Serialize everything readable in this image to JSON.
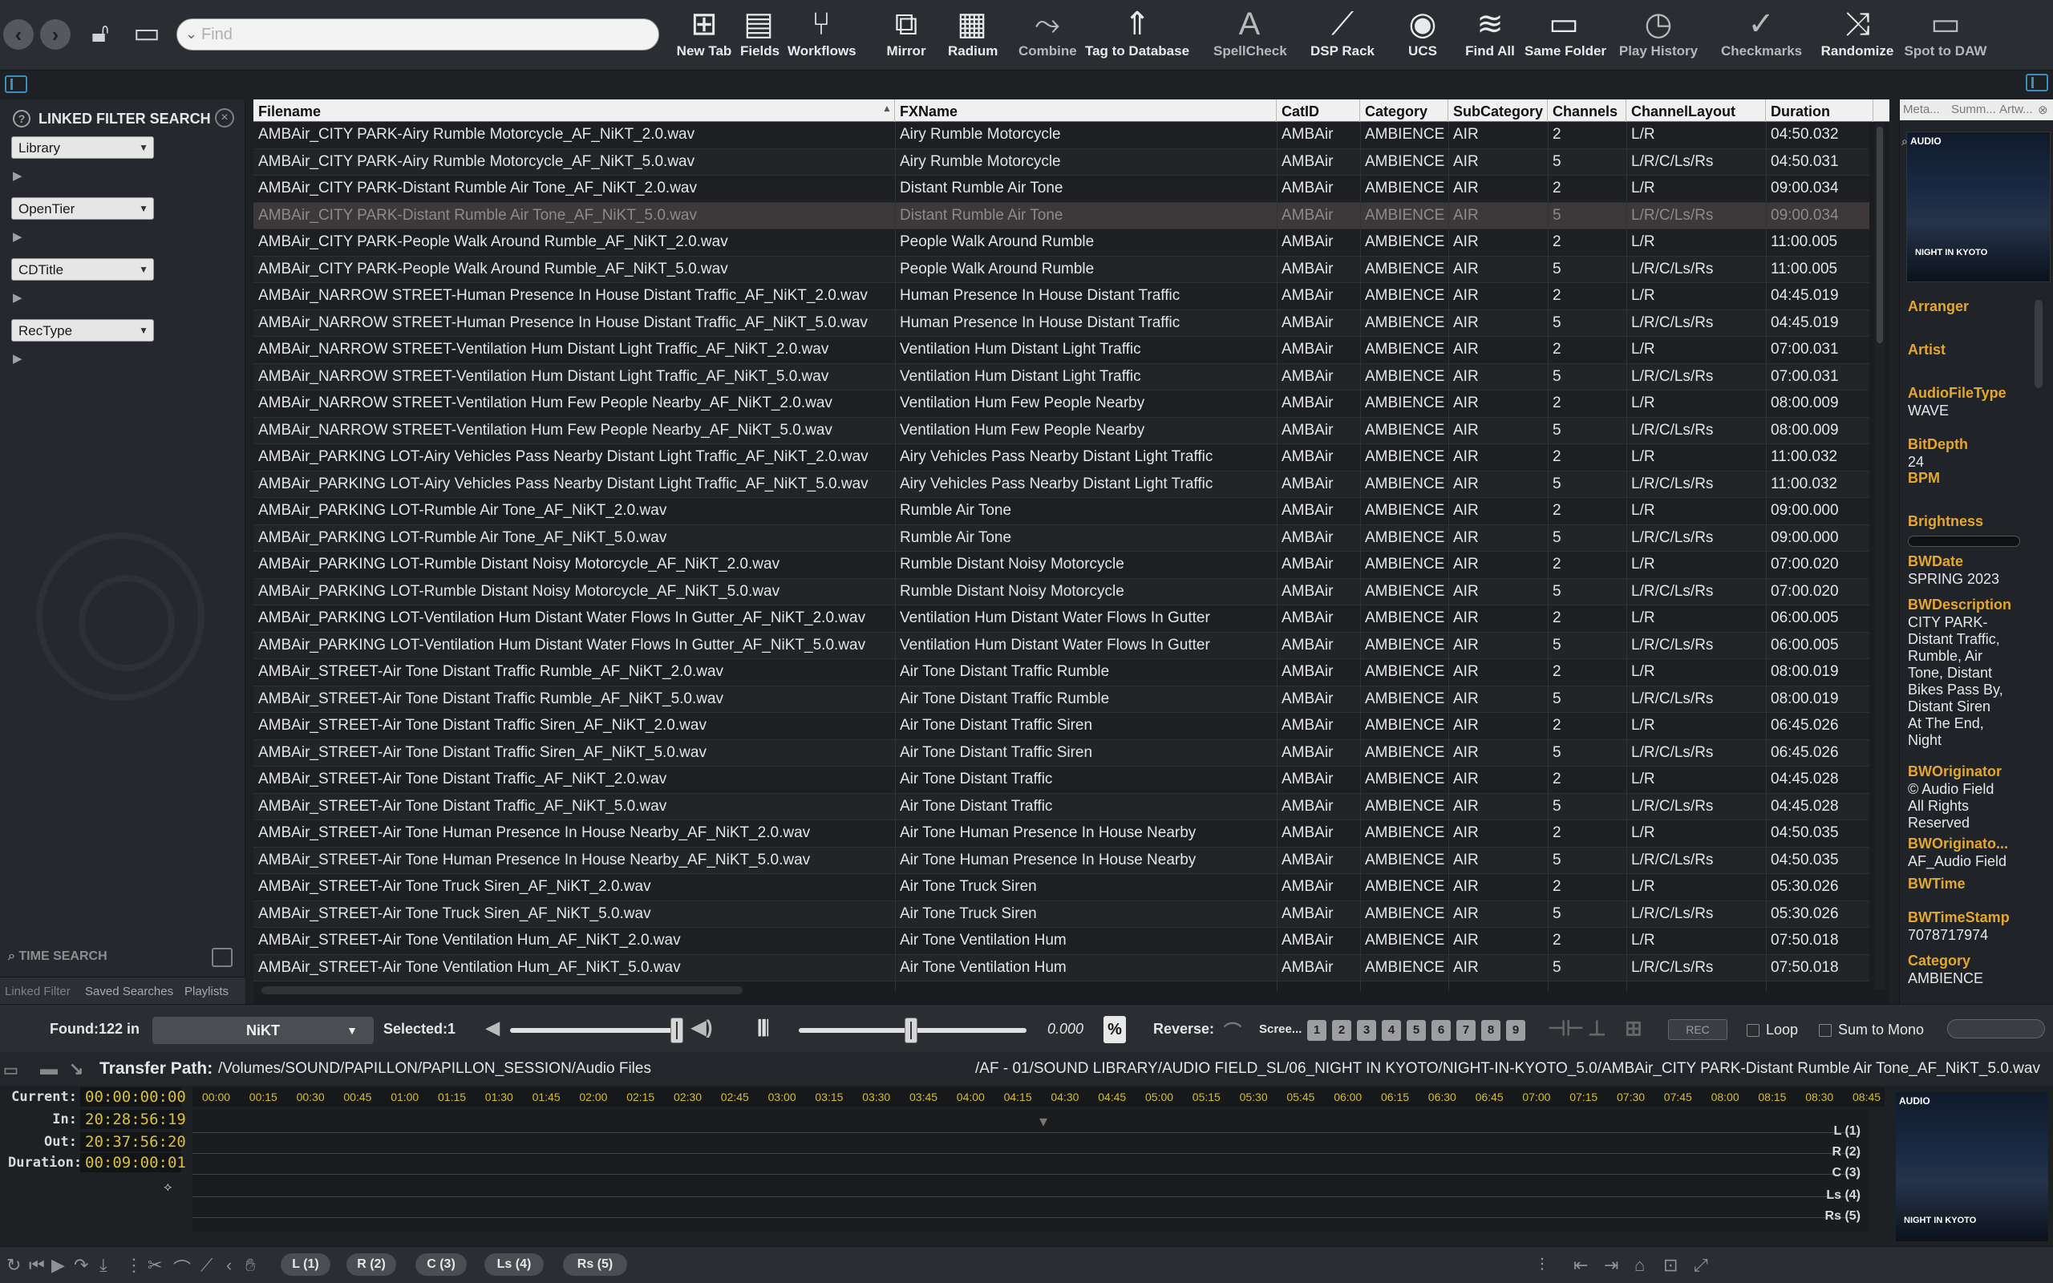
{
  "toolbar": {
    "search_placeholder": "Find",
    "buttons": [
      {
        "label": "New Tab",
        "icon": "new-tab-icon",
        "glyph": "⊞"
      },
      {
        "label": "Fields",
        "icon": "fields-icon",
        "glyph": "▤"
      },
      {
        "label": "Workflows",
        "icon": "workflows-icon",
        "glyph": "⑂"
      },
      {
        "label": "Mirror",
        "icon": "mirror-icon",
        "glyph": "⧉"
      },
      {
        "label": "Radium",
        "icon": "radium-icon",
        "glyph": "▦"
      },
      {
        "label": "Combine",
        "icon": "combine-icon",
        "glyph": "⤳"
      },
      {
        "label": "Tag to Database",
        "icon": "tag-database-icon",
        "glyph": "⇑"
      },
      {
        "label": "SpellCheck",
        "icon": "spellcheck-icon",
        "glyph": "A"
      },
      {
        "label": "DSP Rack",
        "icon": "dsp-rack-icon",
        "glyph": "⟋"
      },
      {
        "label": "UCS",
        "icon": "ucs-icon",
        "glyph": "◉"
      },
      {
        "label": "Find All",
        "icon": "find-all-icon",
        "glyph": "≋"
      },
      {
        "label": "Same Folder",
        "icon": "folder-icon",
        "glyph": "▭"
      },
      {
        "label": "Play History",
        "icon": "clock-icon",
        "glyph": "◷"
      },
      {
        "label": "Checkmarks",
        "icon": "checkmark-icon",
        "glyph": "✓"
      },
      {
        "label": "Randomize",
        "icon": "shuffle-icon",
        "glyph": "⤨"
      },
      {
        "label": "Spot to DAW",
        "icon": "monitor-icon",
        "glyph": "▭"
      }
    ]
  },
  "left_panel": {
    "title": "LINKED FILTER SEARCH",
    "filters": [
      "Library",
      "OpenTier",
      "CDTitle",
      "RecType"
    ],
    "time_search": "TIME SEARCH",
    "tabs": [
      "Linked Filter",
      "Saved Searches",
      "Playlists"
    ]
  },
  "table": {
    "columns": [
      "Filename",
      "FXName",
      "CatID",
      "Category",
      "SubCategory",
      "Channels",
      "ChannelLayout",
      "Duration"
    ],
    "selected_index": 3,
    "rows": [
      [
        "AMBAir_CITY PARK-Airy Rumble Motorcycle_AF_NiKT_2.0.wav",
        "Airy Rumble Motorcycle",
        "AMBAir",
        "AMBIENCE",
        "AIR",
        "2",
        "L/R",
        "04:50.032"
      ],
      [
        "AMBAir_CITY PARK-Airy Rumble Motorcycle_AF_NiKT_5.0.wav",
        "Airy Rumble Motorcycle",
        "AMBAir",
        "AMBIENCE",
        "AIR",
        "5",
        "L/R/C/Ls/Rs",
        "04:50.031"
      ],
      [
        "AMBAir_CITY PARK-Distant Rumble Air Tone_AF_NiKT_2.0.wav",
        "Distant Rumble Air Tone",
        "AMBAir",
        "AMBIENCE",
        "AIR",
        "2",
        "L/R",
        "09:00.034"
      ],
      [
        "AMBAir_CITY PARK-Distant Rumble Air Tone_AF_NiKT_5.0.wav",
        "Distant Rumble Air Tone",
        "AMBAir",
        "AMBIENCE",
        "AIR",
        "5",
        "L/R/C/Ls/Rs",
        "09:00.034"
      ],
      [
        "AMBAir_CITY PARK-People Walk Around Rumble_AF_NiKT_2.0.wav",
        "People Walk Around Rumble",
        "AMBAir",
        "AMBIENCE",
        "AIR",
        "2",
        "L/R",
        "11:00.005"
      ],
      [
        "AMBAir_CITY PARK-People Walk Around Rumble_AF_NiKT_5.0.wav",
        "People Walk Around Rumble",
        "AMBAir",
        "AMBIENCE",
        "AIR",
        "5",
        "L/R/C/Ls/Rs",
        "11:00.005"
      ],
      [
        "AMBAir_NARROW STREET-Human Presence In House Distant Traffic_AF_NiKT_2.0.wav",
        "Human Presence In House Distant Traffic",
        "AMBAir",
        "AMBIENCE",
        "AIR",
        "2",
        "L/R",
        "04:45.019"
      ],
      [
        "AMBAir_NARROW STREET-Human Presence In House Distant Traffic_AF_NiKT_5.0.wav",
        "Human Presence In House Distant Traffic",
        "AMBAir",
        "AMBIENCE",
        "AIR",
        "5",
        "L/R/C/Ls/Rs",
        "04:45.019"
      ],
      [
        "AMBAir_NARROW STREET-Ventilation Hum Distant Light Traffic_AF_NiKT_2.0.wav",
        "Ventilation Hum Distant Light Traffic",
        "AMBAir",
        "AMBIENCE",
        "AIR",
        "2",
        "L/R",
        "07:00.031"
      ],
      [
        "AMBAir_NARROW STREET-Ventilation Hum Distant Light Traffic_AF_NiKT_5.0.wav",
        "Ventilation Hum Distant Light Traffic",
        "AMBAir",
        "AMBIENCE",
        "AIR",
        "5",
        "L/R/C/Ls/Rs",
        "07:00.031"
      ],
      [
        "AMBAir_NARROW STREET-Ventilation Hum Few People Nearby_AF_NiKT_2.0.wav",
        "Ventilation Hum Few People Nearby",
        "AMBAir",
        "AMBIENCE",
        "AIR",
        "2",
        "L/R",
        "08:00.009"
      ],
      [
        "AMBAir_NARROW STREET-Ventilation Hum Few People Nearby_AF_NiKT_5.0.wav",
        "Ventilation Hum Few People Nearby",
        "AMBAir",
        "AMBIENCE",
        "AIR",
        "5",
        "L/R/C/Ls/Rs",
        "08:00.009"
      ],
      [
        "AMBAir_PARKING LOT-Airy Vehicles Pass Nearby Distant Light Traffic_AF_NiKT_2.0.wav",
        "Airy Vehicles Pass Nearby Distant Light Traffic",
        "AMBAir",
        "AMBIENCE",
        "AIR",
        "2",
        "L/R",
        "11:00.032"
      ],
      [
        "AMBAir_PARKING LOT-Airy Vehicles Pass Nearby Distant Light Traffic_AF_NiKT_5.0.wav",
        "Airy Vehicles Pass Nearby Distant Light Traffic",
        "AMBAir",
        "AMBIENCE",
        "AIR",
        "5",
        "L/R/C/Ls/Rs",
        "11:00.032"
      ],
      [
        "AMBAir_PARKING LOT-Rumble Air Tone_AF_NiKT_2.0.wav",
        "Rumble Air Tone",
        "AMBAir",
        "AMBIENCE",
        "AIR",
        "2",
        "L/R",
        "09:00.000"
      ],
      [
        "AMBAir_PARKING LOT-Rumble Air Tone_AF_NiKT_5.0.wav",
        "Rumble Air Tone",
        "AMBAir",
        "AMBIENCE",
        "AIR",
        "5",
        "L/R/C/Ls/Rs",
        "09:00.000"
      ],
      [
        "AMBAir_PARKING LOT-Rumble Distant Noisy Motorcycle_AF_NiKT_2.0.wav",
        "Rumble Distant Noisy Motorcycle",
        "AMBAir",
        "AMBIENCE",
        "AIR",
        "2",
        "L/R",
        "07:00.020"
      ],
      [
        "AMBAir_PARKING LOT-Rumble Distant Noisy Motorcycle_AF_NiKT_5.0.wav",
        "Rumble Distant Noisy Motorcycle",
        "AMBAir",
        "AMBIENCE",
        "AIR",
        "5",
        "L/R/C/Ls/Rs",
        "07:00.020"
      ],
      [
        "AMBAir_PARKING LOT-Ventilation Hum Distant Water Flows In Gutter_AF_NiKT_2.0.wav",
        "Ventilation Hum Distant Water Flows In Gutter",
        "AMBAir",
        "AMBIENCE",
        "AIR",
        "2",
        "L/R",
        "06:00.005"
      ],
      [
        "AMBAir_PARKING LOT-Ventilation Hum Distant Water Flows In Gutter_AF_NiKT_5.0.wav",
        "Ventilation Hum Distant Water Flows In Gutter",
        "AMBAir",
        "AMBIENCE",
        "AIR",
        "5",
        "L/R/C/Ls/Rs",
        "06:00.005"
      ],
      [
        "AMBAir_STREET-Air Tone Distant Traffic Rumble_AF_NiKT_2.0.wav",
        "Air Tone Distant Traffic Rumble",
        "AMBAir",
        "AMBIENCE",
        "AIR",
        "2",
        "L/R",
        "08:00.019"
      ],
      [
        "AMBAir_STREET-Air Tone Distant Traffic Rumble_AF_NiKT_5.0.wav",
        "Air Tone Distant Traffic Rumble",
        "AMBAir",
        "AMBIENCE",
        "AIR",
        "5",
        "L/R/C/Ls/Rs",
        "08:00.019"
      ],
      [
        "AMBAir_STREET-Air Tone Distant Traffic Siren_AF_NiKT_2.0.wav",
        "Air Tone Distant Traffic Siren",
        "AMBAir",
        "AMBIENCE",
        "AIR",
        "2",
        "L/R",
        "06:45.026"
      ],
      [
        "AMBAir_STREET-Air Tone Distant Traffic Siren_AF_NiKT_5.0.wav",
        "Air Tone Distant Traffic Siren",
        "AMBAir",
        "AMBIENCE",
        "AIR",
        "5",
        "L/R/C/Ls/Rs",
        "06:45.026"
      ],
      [
        "AMBAir_STREET-Air Tone Distant Traffic_AF_NiKT_2.0.wav",
        "Air Tone Distant Traffic",
        "AMBAir",
        "AMBIENCE",
        "AIR",
        "2",
        "L/R",
        "04:45.028"
      ],
      [
        "AMBAir_STREET-Air Tone Distant Traffic_AF_NiKT_5.0.wav",
        "Air Tone Distant Traffic",
        "AMBAir",
        "AMBIENCE",
        "AIR",
        "5",
        "L/R/C/Ls/Rs",
        "04:45.028"
      ],
      [
        "AMBAir_STREET-Air Tone Human Presence In House Nearby_AF_NiKT_2.0.wav",
        "Air Tone Human Presence In House Nearby",
        "AMBAir",
        "AMBIENCE",
        "AIR",
        "2",
        "L/R",
        "04:50.035"
      ],
      [
        "AMBAir_STREET-Air Tone Human Presence In House Nearby_AF_NiKT_5.0.wav",
        "Air Tone Human Presence In House Nearby",
        "AMBAir",
        "AMBIENCE",
        "AIR",
        "5",
        "L/R/C/Ls/Rs",
        "04:50.035"
      ],
      [
        "AMBAir_STREET-Air Tone Truck Siren_AF_NiKT_2.0.wav",
        "Air Tone Truck Siren",
        "AMBAir",
        "AMBIENCE",
        "AIR",
        "2",
        "L/R",
        "05:30.026"
      ],
      [
        "AMBAir_STREET-Air Tone Truck Siren_AF_NiKT_5.0.wav",
        "Air Tone Truck Siren",
        "AMBAir",
        "AMBIENCE",
        "AIR",
        "5",
        "L/R/C/Ls/Rs",
        "05:30.026"
      ],
      [
        "AMBAir_STREET-Air Tone Ventilation Hum_AF_NiKT_2.0.wav",
        "Air Tone Ventilation Hum",
        "AMBAir",
        "AMBIENCE",
        "AIR",
        "2",
        "L/R",
        "07:50.018"
      ],
      [
        "AMBAir_STREET-Air Tone Ventilation Hum_AF_NiKT_5.0.wav",
        "Air Tone Ventilation Hum",
        "AMBAir",
        "AMBIENCE",
        "AIR",
        "5",
        "L/R/C/Ls/Rs",
        "07:50.018"
      ]
    ]
  },
  "right_panel": {
    "tabs": [
      "Meta...",
      "Summ...",
      "Artw..."
    ],
    "art_title": "NIGHT IN KYOTO",
    "art_logo": "AUDIO",
    "fields": [
      {
        "key": "Arranger",
        "value": ""
      },
      {
        "key": "Artist",
        "value": ""
      },
      {
        "key": "AudioFileType",
        "value": "WAVE"
      },
      {
        "key": "BitDepth",
        "value": "24"
      },
      {
        "key": "BPM",
        "value": ""
      },
      {
        "key": "Brightness",
        "value": ""
      },
      {
        "key": "BWDate",
        "value": "SPRING 2023"
      },
      {
        "key": "BWDescription",
        "value": "CITY PARK-\nDistant Traffic,\nRumble, Air\nTone, Distant\nBikes Pass By,\nDistant Siren\nAt The End,\nNight"
      },
      {
        "key": "BWOriginator",
        "value": "© Audio Field\nAll Rights\nReserved"
      },
      {
        "key": "BWOriginato...",
        "value": "AF_Audio Field"
      },
      {
        "key": "BWTime",
        "value": ""
      },
      {
        "key": "BWTimeStamp",
        "value": "7078717974"
      },
      {
        "key": "Category",
        "value": "AMBIENCE"
      }
    ]
  },
  "transport": {
    "found": "Found:122 in",
    "library": "NiKT",
    "selected": "Selected:1",
    "pitch_value": "0.000",
    "percent": "%",
    "reverse": "Reverse:",
    "screen": "Scree...",
    "screen_numbers": [
      "1",
      "2",
      "3",
      "4",
      "5",
      "6",
      "7",
      "8",
      "9"
    ],
    "rec": "REC",
    "loop": "Loop",
    "sum_to_mono": "Sum to Mono"
  },
  "pathbar": {
    "label": "Transfer Path:",
    "transfer_path": "/Volumes/SOUND/PAPILLON/PAPILLON_SESSION/Audio Files",
    "file_path": "/AF - 01/SOUND LIBRARY/AUDIO FIELD_SL/06_NIGHT IN KYOTO/NIGHT-IN-KYOTO_5.0/AMBAir_CITY PARK-Distant Rumble Air Tone_AF_NiKT_5.0.wav"
  },
  "timeline": {
    "current_label": "Current:",
    "current": "00:00:00:00",
    "in_label": "In:",
    "in": "20:28:56:19",
    "out_label": "Out:",
    "out": "20:37:56:20",
    "duration_label": "Duration:",
    "duration": "00:09:00:01",
    "ticks": [
      "00:00",
      "00:15",
      "00:30",
      "00:45",
      "01:00",
      "01:15",
      "01:30",
      "01:45",
      "02:00",
      "02:15",
      "02:30",
      "02:45",
      "03:00",
      "03:15",
      "03:30",
      "03:45",
      "04:00",
      "04:15",
      "04:30",
      "04:45",
      "05:00",
      "05:15",
      "05:30",
      "05:45",
      "06:00",
      "06:15",
      "06:30",
      "06:45",
      "07:00",
      "07:15",
      "07:30",
      "07:45",
      "08:00",
      "08:15",
      "08:30",
      "08:45"
    ],
    "tracks": [
      "L (1)",
      "R (2)",
      "C (3)",
      "Ls (4)",
      "Rs (5)"
    ]
  },
  "bottombar": {
    "channels": [
      "L (1)",
      "R (2)",
      "C (3)",
      "Ls (4)",
      "Rs (5)"
    ]
  }
}
